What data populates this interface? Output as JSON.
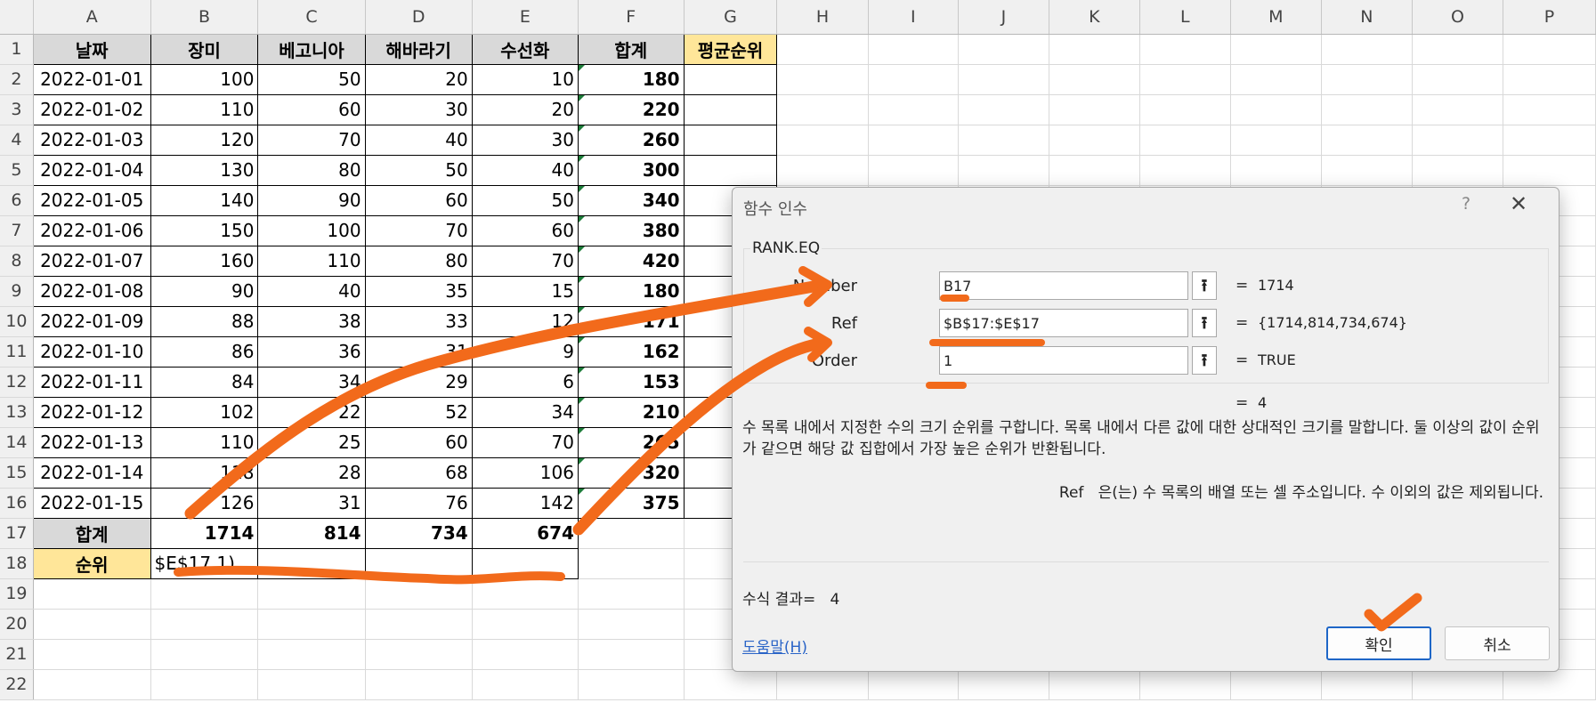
{
  "sheet": {
    "column_headers": [
      "A",
      "B",
      "C",
      "D",
      "E",
      "F",
      "G",
      "H",
      "I",
      "J",
      "K",
      "L",
      "M",
      "N",
      "O",
      "P"
    ],
    "row_numbers": [
      "1",
      "2",
      "3",
      "4",
      "5",
      "6",
      "7",
      "8",
      "9",
      "10",
      "11",
      "12",
      "13",
      "14",
      "15",
      "16",
      "17",
      "18",
      "19",
      "20",
      "21",
      "22"
    ],
    "table_headers": [
      "날짜",
      "장미",
      "베고니아",
      "해바라기",
      "수선화",
      "합계",
      "평균순위"
    ],
    "rows": [
      [
        "2022-01-01",
        "100",
        "50",
        "20",
        "10",
        "180"
      ],
      [
        "2022-01-02",
        "110",
        "60",
        "30",
        "20",
        "220"
      ],
      [
        "2022-01-03",
        "120",
        "70",
        "40",
        "30",
        "260"
      ],
      [
        "2022-01-04",
        "130",
        "80",
        "50",
        "40",
        "300"
      ],
      [
        "2022-01-05",
        "140",
        "90",
        "60",
        "50",
        "340"
      ],
      [
        "2022-01-06",
        "150",
        "100",
        "70",
        "60",
        "380"
      ],
      [
        "2022-01-07",
        "160",
        "110",
        "80",
        "70",
        "420"
      ],
      [
        "2022-01-08",
        "90",
        "40",
        "35",
        "15",
        "180"
      ],
      [
        "2022-01-09",
        "88",
        "38",
        "33",
        "12",
        "171"
      ],
      [
        "2022-01-10",
        "86",
        "36",
        "31",
        "9",
        "162"
      ],
      [
        "2022-01-11",
        "84",
        "34",
        "29",
        "6",
        "153"
      ],
      [
        "2022-01-12",
        "102",
        "22",
        "52",
        "34",
        "210"
      ],
      [
        "2022-01-13",
        "110",
        "25",
        "60",
        "70",
        "265"
      ],
      [
        "2022-01-14",
        "118",
        "28",
        "68",
        "106",
        "320"
      ],
      [
        "2022-01-15",
        "126",
        "31",
        "76",
        "142",
        "375"
      ]
    ],
    "total_label": "합계",
    "totals": [
      "1714",
      "814",
      "734",
      "674"
    ],
    "rank_label": "순위",
    "rank_formula": "$E$17,1)"
  },
  "dialog": {
    "title": "함수 인수",
    "help_icon": "?",
    "close_icon": "✕",
    "function_name": "RANK.EQ",
    "args": [
      {
        "label": "Number",
        "value": "B17",
        "result": "1714"
      },
      {
        "label": "Ref",
        "value": "$B$17:$E$17",
        "result": "{1714,814,734,674}"
      },
      {
        "label": "Order",
        "value": "1",
        "result": "TRUE"
      }
    ],
    "equals": "=",
    "overall_result": "4",
    "description": "수 목록 내에서 지정한 수의 크기 순위를 구합니다. 목록 내에서 다른 값에 대한 상대적인 크기를 말합니다. 둘 이상의 값이 순위가 같으면 해당 값 집합에서 가장 높은 순위가 반환됩니다.",
    "arg_help_name": "Ref",
    "arg_help_text": "은(는) 수 목록의 배열 또는 셀 주소입니다. 수 이외의 값은 제외됩니다.",
    "formula_result_label": "수식 결과=",
    "formula_result_value": "4",
    "help_link": "도움말(H)",
    "ok_label": "확인",
    "cancel_label": "취소"
  },
  "colors": {
    "header_fill": "#d9d9d9",
    "yellow_fill": "#ffe699",
    "annotation_orange": "#f26a1b",
    "triangle_green": "#1d7d3a",
    "link_blue": "#2a64c7"
  }
}
